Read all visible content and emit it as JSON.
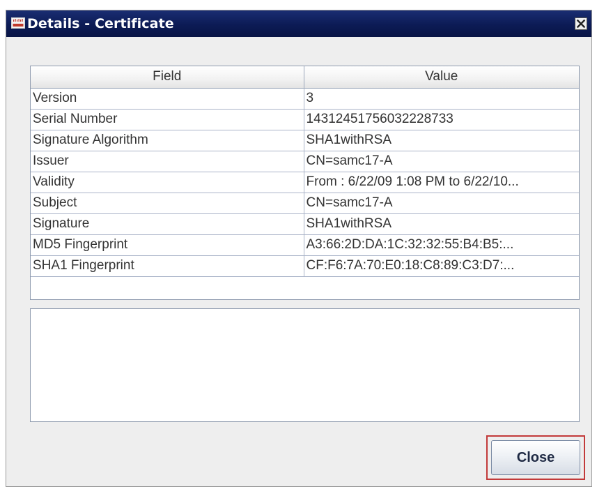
{
  "window": {
    "title": "Details - Certificate"
  },
  "table": {
    "columns": [
      "Field",
      "Value"
    ],
    "rows": [
      {
        "field": "Version",
        "value": "3"
      },
      {
        "field": "Serial Number",
        "value": "14312451756032228733"
      },
      {
        "field": "Signature Algorithm",
        "value": "SHA1withRSA"
      },
      {
        "field": "Issuer",
        "value": "CN=samc17-A"
      },
      {
        "field": "Validity",
        "value": "From : 6/22/09 1:08 PM to 6/22/10..."
      },
      {
        "field": "Subject",
        "value": "CN=samc17-A"
      },
      {
        "field": "Signature",
        "value": "SHA1withRSA"
      },
      {
        "field": "MD5 Fingerprint",
        "value": "A3:66:2D:DA:1C:32:32:55:B4:B5:..."
      },
      {
        "field": "SHA1 Fingerprint",
        "value": "CF:F6:7A:70:E0:18:C8:89:C3:D7:..."
      }
    ]
  },
  "buttons": {
    "close_label": "Close"
  },
  "icons": {
    "app": "cisco-app-icon",
    "window_close": "close-icon"
  },
  "colors": {
    "titlebar": "#0c1b55",
    "focus_border": "#c23a3a"
  }
}
